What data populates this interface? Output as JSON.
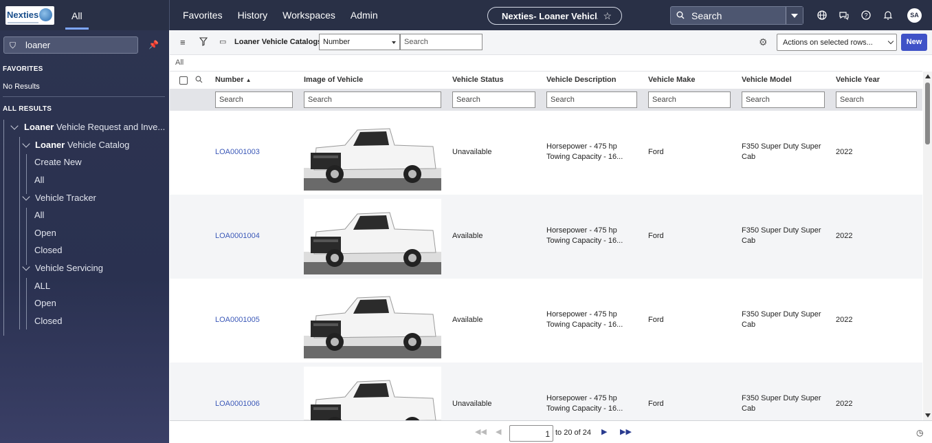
{
  "topbar": {
    "logo_text": "Nexties",
    "all_label": "All",
    "nav": [
      "Favorites",
      "History",
      "Workspaces",
      "Admin"
    ],
    "context_title": "Nexties- Loaner Vehicl...",
    "search_placeholder": "Search",
    "avatar_initials": "SA",
    "icons": [
      "globe-icon",
      "chat-icon",
      "help-icon",
      "bell-icon"
    ]
  },
  "sidebar": {
    "filter_value": "loaner",
    "favorites_heading": "FAVORITES",
    "favorites_empty": "No Results",
    "all_results_heading": "ALL RESULTS",
    "tree": {
      "root_bold": "Loaner",
      "root_rest": " Vehicle Request and Inve...",
      "catalog_bold": "Loaner",
      "catalog_rest": " Vehicle Catalog",
      "catalog_items": [
        "Create New",
        "All"
      ],
      "tracker_label": "Vehicle Tracker",
      "tracker_items": [
        "All",
        "Open",
        "Closed"
      ],
      "servicing_label": "Vehicle Servicing",
      "servicing_items": [
        "ALL",
        "Open",
        "Closed"
      ]
    }
  },
  "toolbar": {
    "list_title": "Loaner Vehicle Catalogs",
    "field_select": "Number",
    "search_placeholder": "Search",
    "actions_label": "Actions on selected rows...",
    "new_label": "New"
  },
  "breadcrumb": "All",
  "table": {
    "columns": [
      "Number",
      "Image of Vehicle",
      "Vehicle Status",
      "Vehicle Description",
      "Vehicle Make",
      "Vehicle Model",
      "Vehicle Year"
    ],
    "column_search_placeholder": "Search",
    "rows": [
      {
        "number": "LOA0001003",
        "status": "Unavailable",
        "desc1": "Horsepower - 475 hp",
        "desc2": "Towing Capacity - 16...",
        "make": "Ford",
        "model1": "F350 Super Duty Super",
        "model2": "Cab",
        "year": "2022"
      },
      {
        "number": "LOA0001004",
        "status": "Available",
        "desc1": "Horsepower - 475 hp",
        "desc2": "Towing Capacity - 16...",
        "make": "Ford",
        "model1": "F350 Super Duty Super",
        "model2": "Cab",
        "year": "2022"
      },
      {
        "number": "LOA0001005",
        "status": "Available",
        "desc1": "Horsepower - 475 hp",
        "desc2": "Towing Capacity - 16...",
        "make": "Ford",
        "model1": "F350 Super Duty Super",
        "model2": "Cab",
        "year": "2022"
      },
      {
        "number": "LOA0001006",
        "status": "Unavailable",
        "desc1": "Horsepower - 475 hp",
        "desc2": "Towing Capacity - 16...",
        "make": "Ford",
        "model1": "F350 Super Duty Super",
        "model2": "Cab",
        "year": "2022"
      }
    ]
  },
  "pager": {
    "page_value": "1",
    "range_text": "to 20 of 24"
  },
  "colors": {
    "topbar": "#293046",
    "accent": "#3f52c7",
    "link": "#3c59b8"
  }
}
